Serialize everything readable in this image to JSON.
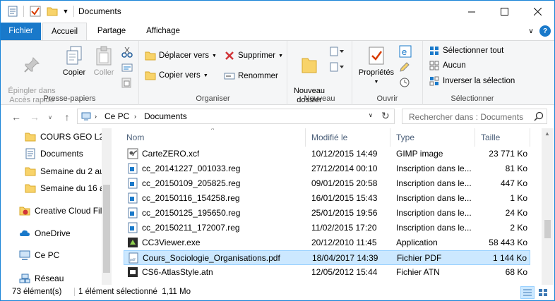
{
  "window": {
    "title": "Documents"
  },
  "tabs": [
    {
      "label": "Fichier"
    },
    {
      "label": "Accueil"
    },
    {
      "label": "Partage"
    },
    {
      "label": "Affichage"
    }
  ],
  "ribbon": {
    "presse_papiers": {
      "label": "Presse-papiers",
      "epingler": "Épingler dans\nAccès rapide",
      "copier": "Copier",
      "coller": "Coller"
    },
    "organiser": {
      "label": "Organiser",
      "deplacer": "Déplacer vers",
      "copier_vers": "Copier vers",
      "supprimer": "Supprimer",
      "renommer": "Renommer"
    },
    "nouveau": {
      "label": "Nouveau",
      "nouveau_dossier": "Nouveau\ndossier"
    },
    "ouvrir": {
      "label": "Ouvrir",
      "proprietes": "Propriétés"
    },
    "selectionner": {
      "label": "Sélectionner",
      "tout": "Sélectionner tout",
      "aucun": "Aucun",
      "inverser": "Inverser la sélection"
    }
  },
  "address": {
    "segments": [
      "Ce PC",
      "Documents"
    ],
    "search_placeholder": "Rechercher dans : Documents"
  },
  "navpane": {
    "items": [
      {
        "label": "COURS GEO L2",
        "icon": "folder-icon"
      },
      {
        "label": "Documents",
        "icon": "documents-icon"
      },
      {
        "label": "Semaine du 2 au",
        "icon": "folder-icon"
      },
      {
        "label": "Semaine du 16 a",
        "icon": "folder-icon"
      },
      {
        "label": "Creative Cloud Fil",
        "icon": "creative-cloud-icon"
      },
      {
        "label": "OneDrive",
        "icon": "onedrive-icon"
      },
      {
        "label": "Ce PC",
        "icon": "computer-icon"
      },
      {
        "label": "Réseau",
        "icon": "network-icon"
      }
    ]
  },
  "columns": {
    "name": "Nom",
    "date": "Modifié le",
    "type": "Type",
    "size": "Taille"
  },
  "files": [
    {
      "name": "CarteZERO.xcf",
      "date": "10/12/2015 14:49",
      "type": "GIMP image",
      "size": "23 771 Ko",
      "icon": "gimp-file-icon"
    },
    {
      "name": "cc_20141227_001033.reg",
      "date": "27/12/2014 00:10",
      "type": "Inscription dans le...",
      "size": "81 Ko",
      "icon": "registry-file-icon"
    },
    {
      "name": "cc_20150109_205825.reg",
      "date": "09/01/2015 20:58",
      "type": "Inscription dans le...",
      "size": "447 Ko",
      "icon": "registry-file-icon"
    },
    {
      "name": "cc_20150116_154258.reg",
      "date": "16/01/2015 15:43",
      "type": "Inscription dans le...",
      "size": "1 Ko",
      "icon": "registry-file-icon"
    },
    {
      "name": "cc_20150125_195650.reg",
      "date": "25/01/2015 19:56",
      "type": "Inscription dans le...",
      "size": "24 Ko",
      "icon": "registry-file-icon"
    },
    {
      "name": "cc_20150211_172007.reg",
      "date": "11/02/2015 17:20",
      "type": "Inscription dans le...",
      "size": "2 Ko",
      "icon": "registry-file-icon"
    },
    {
      "name": "CC3Viewer.exe",
      "date": "20/12/2010 11:45",
      "type": "Application",
      "size": "58 443 Ko",
      "icon": "application-icon"
    },
    {
      "name": "Cours_Sociologie_Organisations.pdf",
      "date": "18/04/2017 14:39",
      "type": "Fichier PDF",
      "size": "1 144 Ko",
      "icon": "pdf-file-icon",
      "selected": true
    },
    {
      "name": "CS6-AtlasStyle.atn",
      "date": "12/05/2012 15:44",
      "type": "Fichier ATN",
      "size": "68 Ko",
      "icon": "atn-file-icon"
    }
  ],
  "status": {
    "count": "73 élément(s)",
    "selection": "1 élément sélectionné  1,11 Mo"
  },
  "colors": {
    "accent": "#1979ca",
    "selection": "#cce8ff",
    "selection_border": "#99d1ff",
    "header_text": "#4c607a"
  }
}
